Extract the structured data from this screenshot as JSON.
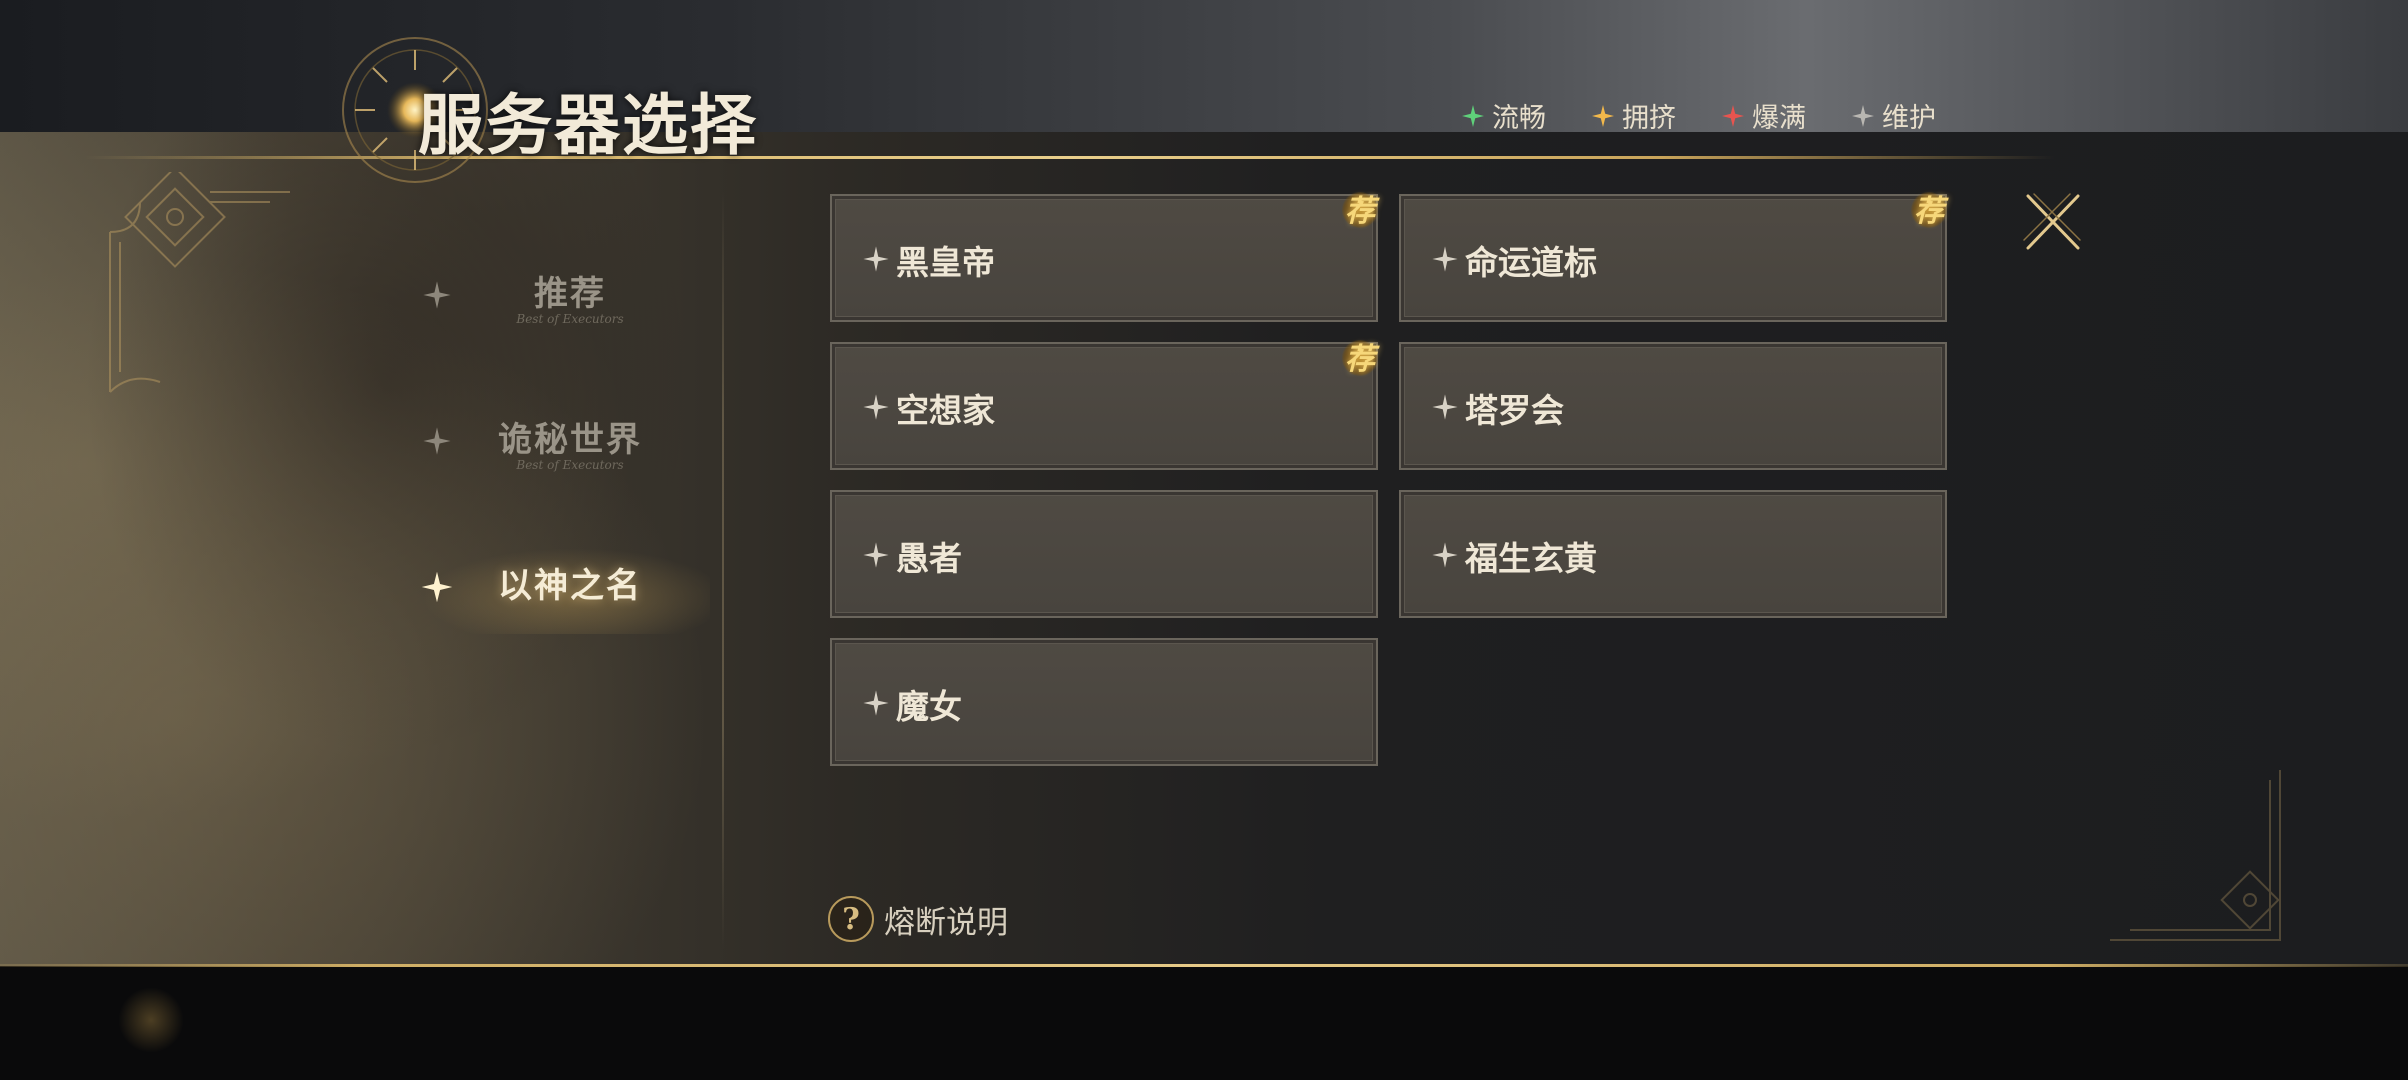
{
  "header": {
    "title": "服务器选择"
  },
  "legend": [
    {
      "label": "流畅",
      "color": "#5fd07a"
    },
    {
      "label": "拥挤",
      "color": "#f2b84b"
    },
    {
      "label": "爆满",
      "color": "#e8544f"
    },
    {
      "label": "维护",
      "color": "#b9b7b2"
    }
  ],
  "sidebar": {
    "items": [
      {
        "label": "推荐",
        "sub": "Best of Executors",
        "active": false
      },
      {
        "label": "诡秘世界",
        "sub": "Best of Executors",
        "active": false
      },
      {
        "label": "以神之名",
        "sub": "",
        "active": true
      }
    ]
  },
  "servers": [
    {
      "name": "黑皇帝",
      "recommended": true,
      "badge": "荐"
    },
    {
      "name": "命运道标",
      "recommended": true,
      "badge": "荐"
    },
    {
      "name": "空想家",
      "recommended": true,
      "badge": "荐"
    },
    {
      "name": "塔罗会",
      "recommended": false,
      "badge": ""
    },
    {
      "name": "愚者",
      "recommended": false,
      "badge": ""
    },
    {
      "name": "福生玄黄",
      "recommended": false,
      "badge": ""
    },
    {
      "name": "魔女",
      "recommended": false,
      "badge": ""
    }
  ],
  "footer": {
    "fuse_label": "熔断说明",
    "fuse_icon": "?"
  }
}
